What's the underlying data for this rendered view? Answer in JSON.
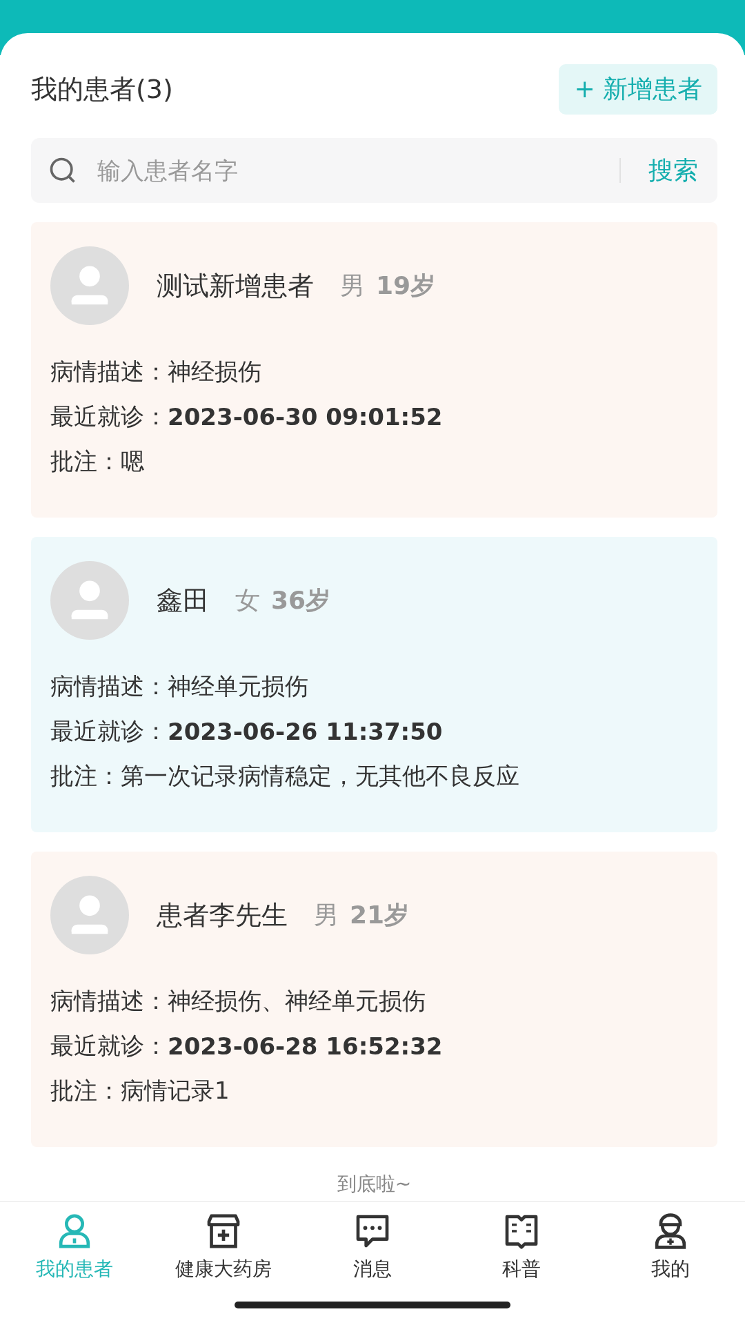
{
  "header": {
    "title": "我的患者(3)",
    "add_button": "+ 新增患者"
  },
  "search": {
    "placeholder": "输入患者名字",
    "button": "搜索"
  },
  "patients": [
    {
      "name": "测试新增患者",
      "gender": "男",
      "age": "19岁",
      "color": "#fdf6f2",
      "condition_label": "病情描述：",
      "condition": "神经损伤",
      "visit_label": "最近就诊：",
      "visit": "2023-06-30 09:01:52",
      "note_label": "批注：",
      "note": "嗯"
    },
    {
      "name": "鑫田",
      "gender": "女",
      "age": "36岁",
      "color": "#eef9fb",
      "condition_label": "病情描述：",
      "condition": "神经单元损伤",
      "visit_label": "最近就诊：",
      "visit": "2023-06-26 11:37:50",
      "note_label": "批注：",
      "note": "第一次记录病情稳定，无其他不良反应"
    },
    {
      "name": "患者李先生",
      "gender": "男",
      "age": "21岁",
      "color": "#fdf6f2",
      "condition_label": "病情描述：",
      "condition": "神经损伤、神经单元损伤",
      "visit_label": "最近就诊：",
      "visit": "2023-06-28 16:52:32",
      "note_label": "批注：",
      "note": "病情记录1"
    }
  ],
  "end_text": "到底啦~",
  "nav": [
    {
      "kind": "person",
      "label": "我的患者",
      "selected": true
    },
    {
      "kind": "store",
      "label": "健康大药房",
      "selected": false
    },
    {
      "kind": "chat",
      "label": "消息",
      "selected": false
    },
    {
      "kind": "book",
      "label": "科普",
      "selected": false
    },
    {
      "kind": "doctor",
      "label": "我的",
      "selected": false
    }
  ]
}
